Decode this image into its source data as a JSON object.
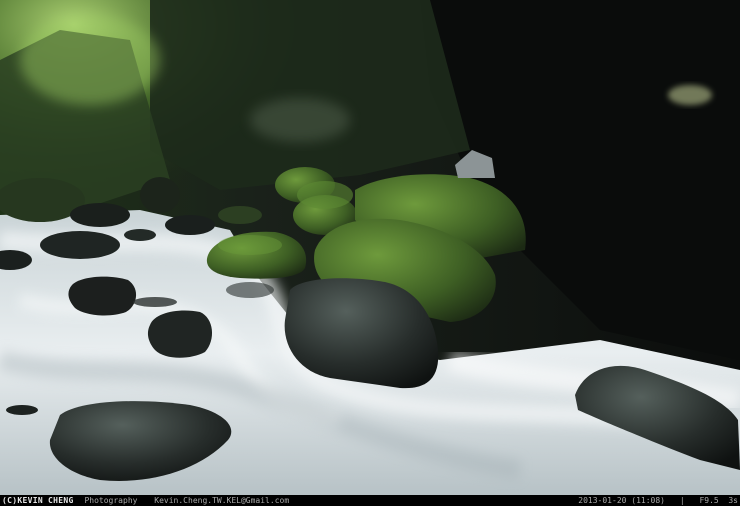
{
  "photo": {
    "subject": "mountain stream long exposure",
    "colors": {
      "water": "#e8eef0",
      "moss": "#4f7a2e",
      "rock": "#1b1e1d",
      "canopy": "#7fae4a"
    }
  },
  "caption": {
    "photographer": "(C)KEVIN CHENG",
    "role": "Photography",
    "email": "Kevin.Cheng.TW.KEL@Gmail.com",
    "timestamp": "2013-01-20 (11:08)",
    "separator": "|",
    "exposure": "F9.5  3s"
  }
}
